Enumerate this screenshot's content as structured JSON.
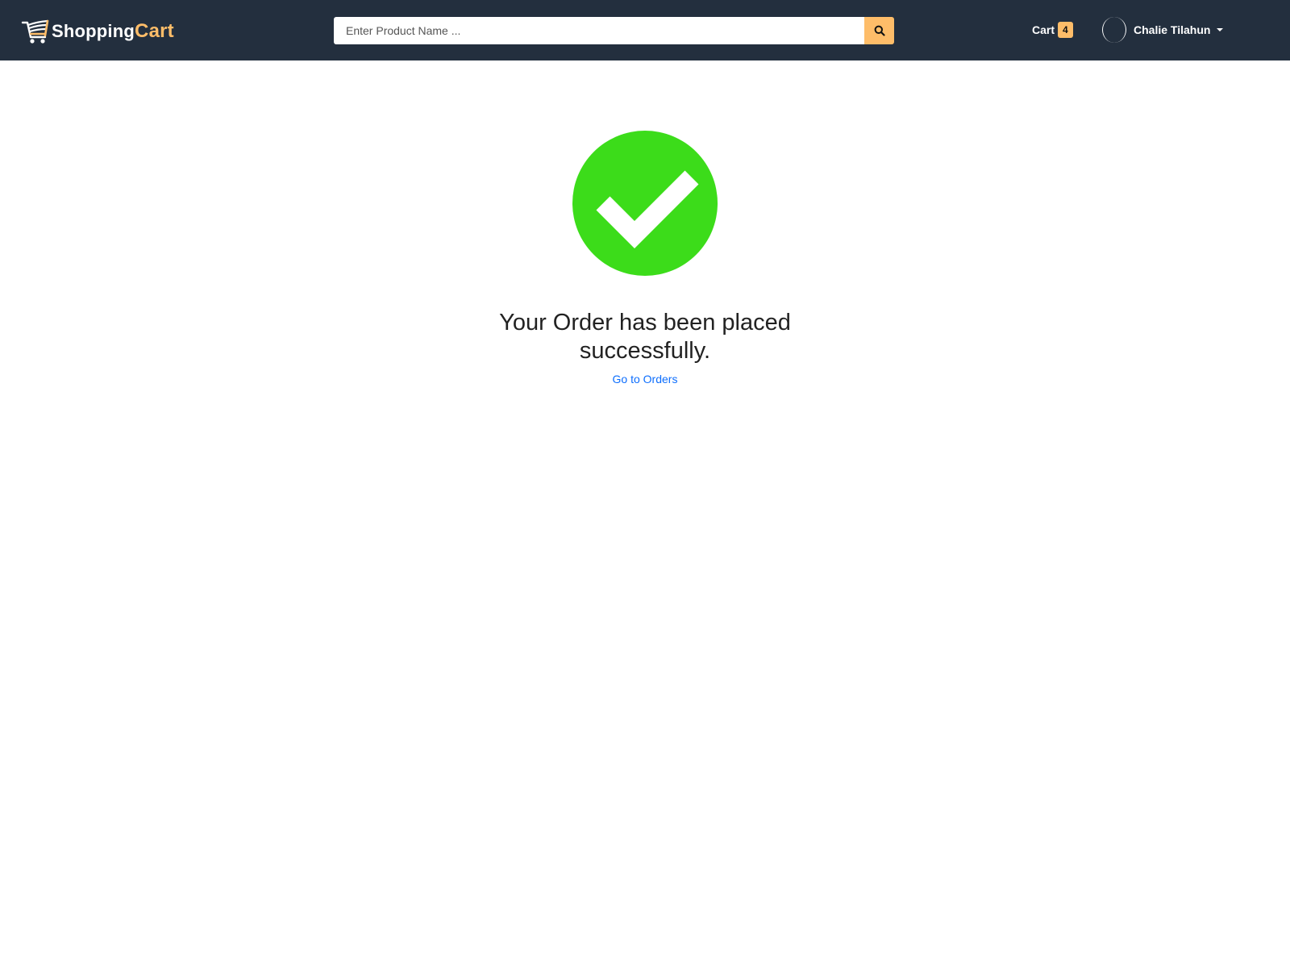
{
  "header": {
    "logo": {
      "text_primary": "Shopping",
      "text_accent": "Cart",
      "icon": "shopping-cart-icon"
    },
    "search": {
      "placeholder": "Enter Product Name ...",
      "value": "",
      "button_icon": "search-icon"
    },
    "cart": {
      "label": "Cart",
      "count": "4"
    },
    "user": {
      "name": "Chalie Tilahun",
      "avatar_icon": "avatar-icon",
      "dropdown_icon": "chevron-down-icon"
    }
  },
  "main": {
    "status_icon": "check-circle-icon",
    "message": "Your Order has been placed successfully.",
    "link_label": "Go to Orders"
  },
  "colors": {
    "navbar": "#232f3e",
    "accent": "#febd69",
    "success": "#3cdc1a",
    "link": "#0d6efd"
  }
}
